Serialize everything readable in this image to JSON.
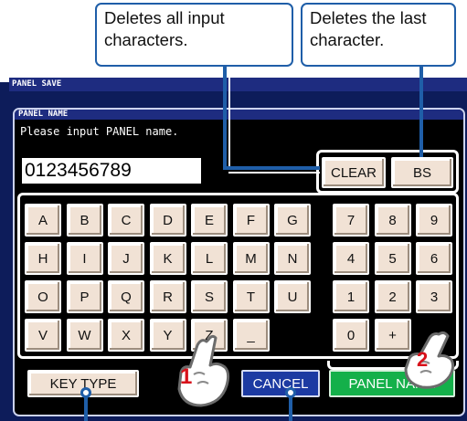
{
  "callouts": {
    "clear_desc": "Deletes all input characters.",
    "bs_desc": "Deletes the last character."
  },
  "window": {
    "title": "PANEL SAVE"
  },
  "dialog": {
    "title": "PANEL NAME",
    "prompt": "Please input PANEL name.",
    "name_value": "0123456789"
  },
  "edit_keys": {
    "clear": "CLEAR",
    "bs": "BS"
  },
  "letter_rows": [
    [
      "A",
      "B",
      "C",
      "D",
      "E",
      "F",
      "G"
    ],
    [
      "H",
      "I",
      "J",
      "K",
      "L",
      "M",
      "N"
    ],
    [
      "O",
      "P",
      "Q",
      "R",
      "S",
      "T",
      "U"
    ],
    [
      "V",
      "W",
      "X",
      "Y",
      "Z",
      "_",
      ""
    ]
  ],
  "digit_rows": [
    [
      "7",
      "8",
      "9"
    ],
    [
      "4",
      "5",
      "6"
    ],
    [
      "1",
      "2",
      "3"
    ],
    [
      "0",
      "+",
      ""
    ]
  ],
  "buttons": {
    "key_type": "KEY TYPE",
    "cancel": "CANCEL",
    "panel_name": "PANEL NAME"
  },
  "step_markers": {
    "step1": "1",
    "step2": "2"
  },
  "icons": {
    "pointer": "pointing-hand-icon"
  },
  "colors": {
    "step_number": "#d8121b",
    "cancel": "#1c3aa2",
    "panel_name": "#14b04a",
    "key": "#f1e2d5",
    "callout_border": "#1f5ea8"
  }
}
